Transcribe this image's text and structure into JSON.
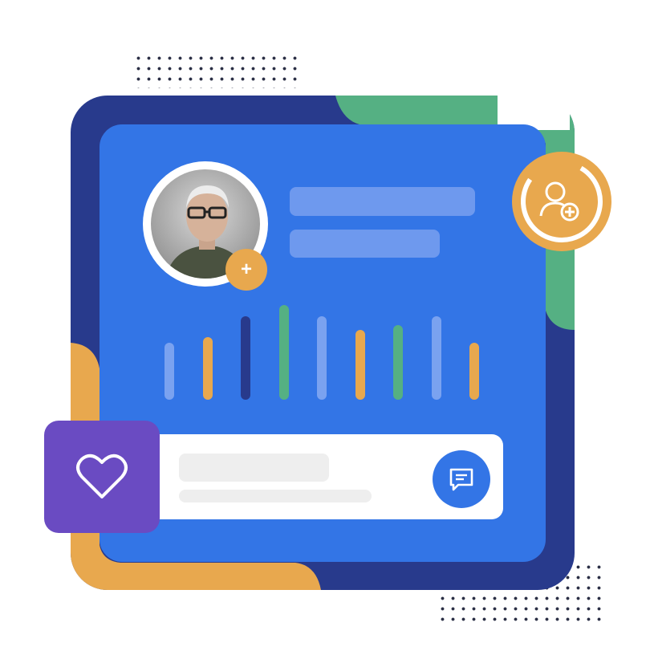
{
  "colors": {
    "navy": "#283a8c",
    "blue": "#3375e6",
    "light_blue": "#6e99ee",
    "pale_bar": "#7aa2f0",
    "green": "#55b083",
    "orange": "#e8a84e",
    "purple": "#6a4bc2",
    "placeholder": "#eeeeee",
    "white": "#ffffff"
  },
  "profile": {
    "avatar": "user-photo",
    "add_badge_symbol": "+"
  },
  "activity_bars": [
    {
      "color": "pale_bar",
      "level": 0.6
    },
    {
      "color": "orange",
      "level": 0.66
    },
    {
      "color": "navy",
      "level": 0.88
    },
    {
      "color": "green",
      "level": 1.0
    },
    {
      "color": "pale_bar",
      "level": 0.88
    },
    {
      "color": "orange",
      "level": 0.74
    },
    {
      "color": "green",
      "level": 0.79
    },
    {
      "color": "pale_bar",
      "level": 0.88
    },
    {
      "color": "orange",
      "level": 0.6
    }
  ],
  "icons": {
    "heart": "heart-icon",
    "chat": "chat-icon",
    "add_user": "add-user-icon"
  }
}
